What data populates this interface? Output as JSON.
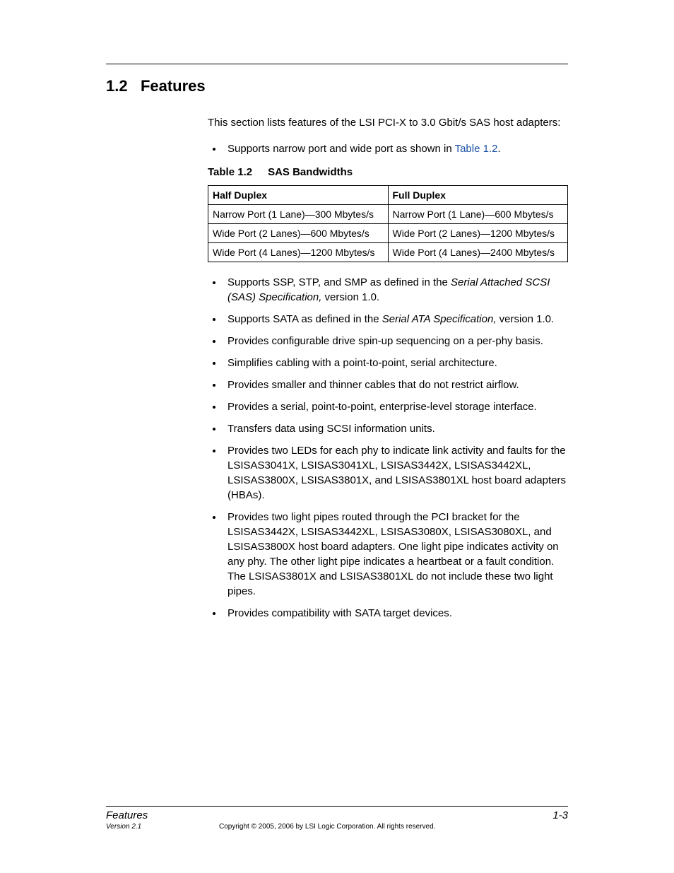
{
  "heading": {
    "number": "1.2",
    "title": "Features"
  },
  "intro": "This section lists features of the LSI PCI-X to 3.0 Gbit/s SAS host adapters:",
  "bullet_top": {
    "text_before_link": "Supports narrow port and wide port as shown in ",
    "link_text": "Table 1.2",
    "text_after_link": "."
  },
  "table_caption": {
    "num": "Table 1.2",
    "title": "SAS Bandwidths"
  },
  "table": {
    "headers": [
      "Half Duplex",
      "Full Duplex"
    ],
    "rows": [
      [
        "Narrow Port (1 Lane)—300 Mbytes/s",
        "Narrow Port (1 Lane)—600 Mbytes/s"
      ],
      [
        "Wide Port (2 Lanes)—600 Mbytes/s",
        "Wide Port (2 Lanes)—1200 Mbytes/s"
      ],
      [
        "Wide Port (4 Lanes)—1200 Mbytes/s",
        "Wide Port (4 Lanes)—2400 Mbytes/s"
      ]
    ]
  },
  "bullets_italic": [
    {
      "pre": "Supports SSP, STP, and SMP as defined in the ",
      "it": "Serial Attached SCSI (SAS) Specification,",
      "post": " version 1.0."
    },
    {
      "pre": "Supports SATA as defined in the ",
      "it": "Serial ATA Specification,",
      "post": " version 1.0."
    }
  ],
  "bullets_plain": [
    "Provides configurable drive spin-up sequencing on a per-phy basis.",
    "Simplifies cabling with a point-to-point, serial architecture.",
    "Provides smaller and thinner cables that do not restrict airflow.",
    "Provides a serial, point-to-point, enterprise-level storage interface.",
    "Transfers data using SCSI information units.",
    "Provides two LEDs for each phy to indicate link activity and faults for the LSISAS3041X, LSISAS3041XL, LSISAS3442X, LSISAS3442XL, LSISAS3800X, LSISAS3801X, and LSISAS3801XL host board adapters (HBAs).",
    "Provides two light pipes routed through the PCI bracket for the LSISAS3442X, LSISAS3442XL, LSISAS3080X, LSISAS3080XL, and LSISAS3800X host board adapters. One light pipe indicates activity on any phy. The other light pipe indicates a heartbeat or a fault condition. The LSISAS3801X and LSISAS3801XL do not include these two light pipes.",
    "Provides compatibility with SATA target devices."
  ],
  "footer": {
    "section": "Features",
    "page": "1-3",
    "version": "Version 2.1",
    "copyright": "Copyright © 2005, 2006 by LSI Logic Corporation. All rights reserved."
  }
}
